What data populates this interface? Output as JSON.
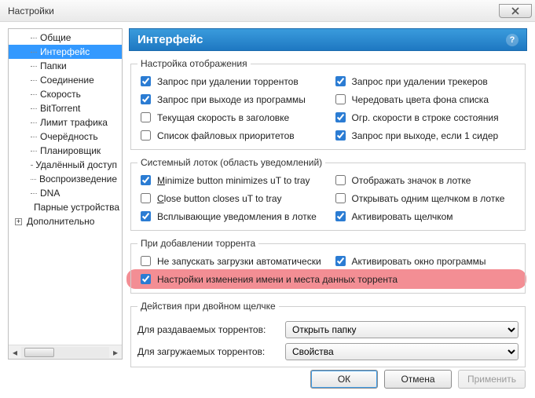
{
  "window": {
    "title": "Настройки"
  },
  "sidebar": {
    "items": [
      {
        "label": "Общие"
      },
      {
        "label": "Интерфейс"
      },
      {
        "label": "Папки"
      },
      {
        "label": "Соединение"
      },
      {
        "label": "Скорость"
      },
      {
        "label": "BitTorrent"
      },
      {
        "label": "Лимит трафика"
      },
      {
        "label": "Очерёдность"
      },
      {
        "label": "Планировщик"
      },
      {
        "label": "Удалённый доступ"
      },
      {
        "label": "Воспроизведение"
      },
      {
        "label": "DNA"
      },
      {
        "label": "Парные устройства"
      }
    ],
    "advanced_label": "Дополнительно",
    "selected_index": 1
  },
  "header": {
    "title": "Интерфейс"
  },
  "groups": {
    "display": {
      "legend": "Настройка отображения",
      "items": [
        {
          "label": "Запрос при удалении торрентов",
          "checked": true
        },
        {
          "label": "Запрос при удалении трекеров",
          "checked": true
        },
        {
          "label": "Запрос при выходе из программы",
          "checked": true
        },
        {
          "label": "Чередовать цвета фона списка",
          "checked": false
        },
        {
          "label": "Текущая скорость в заголовке",
          "checked": false
        },
        {
          "label": "Огр. скорости в строке состояния",
          "checked": true
        },
        {
          "label": "Список файловых приоритетов",
          "checked": false
        },
        {
          "label": "Запрос при выходе, если 1 сидер",
          "checked": true
        }
      ]
    },
    "tray": {
      "legend": "Системный лоток (область уведомлений)",
      "items": [
        {
          "label": "Minimize button minimizes uT to tray",
          "checked": true,
          "u": "M"
        },
        {
          "label": "Отображать значок в лотке",
          "checked": false
        },
        {
          "label": "Close button closes uT to tray",
          "checked": false,
          "u": "C"
        },
        {
          "label": "Открывать одним щелчком в лотке",
          "checked": false
        },
        {
          "label": "Всплывающие уведомления в лотке",
          "checked": true
        },
        {
          "label": "Активировать щелчком",
          "checked": true
        }
      ]
    },
    "adding": {
      "legend": "При добавлении торрента",
      "items": [
        {
          "label": "Не запускать загрузки автоматически",
          "checked": false
        },
        {
          "label": "Активировать окно программы",
          "checked": true
        },
        {
          "label": "Настройки изменения имени и места данных торрента",
          "checked": true,
          "highlight": true,
          "colspan": 2
        }
      ]
    },
    "dblclick": {
      "legend": "Действия при двойном щелчке",
      "seeding": {
        "label": "Для раздаваемых торрентов:",
        "value": "Открыть папку"
      },
      "downloading": {
        "label": "Для загружаемых торрентов:",
        "value": "Свойства"
      }
    }
  },
  "buttons": {
    "ok": "ОК",
    "cancel": "Отмена",
    "apply": "Применить"
  }
}
